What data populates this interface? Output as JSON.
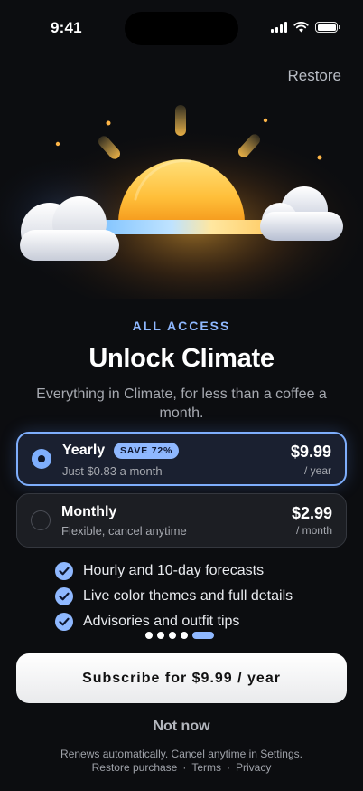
{
  "status": {
    "time": "9:41"
  },
  "header": {
    "restore_label": "Restore"
  },
  "hero": {
    "eyebrow": "ALL ACCESS",
    "title": "Unlock Climate",
    "subtitle": "Everything in Climate, for less than a coffee a month."
  },
  "plans": [
    {
      "name": "Yearly",
      "badge": "SAVE 72%",
      "subtitle": "Just $0.83 a month",
      "price": "$9.99",
      "period": "/ year",
      "selected": true
    },
    {
      "name": "Monthly",
      "subtitle": "Flexible, cancel anytime",
      "price": "$2.99",
      "period": "/ month",
      "selected": false
    }
  ],
  "features": [
    "Hourly and 10-day forecasts",
    "Live color themes and full details",
    "Advisories and outfit tips"
  ],
  "pager": {
    "count": 5,
    "active_index": 4
  },
  "cta": {
    "subscribe_label": "Subscribe for $9.99 / year",
    "not_now_label": "Not now"
  },
  "footer": {
    "renew_text": "Renews automatically. Cancel anytime in Settings.",
    "links": [
      "Restore purchase",
      "Terms",
      "Privacy"
    ],
    "separator": "·"
  },
  "colors": {
    "accent": "#8fb8ff",
    "background": "#0c0d10",
    "sun": "#ffc83a"
  },
  "icons": {
    "check": "check-icon",
    "wifi": "wifi-icon",
    "signal": "signal-icon",
    "battery": "battery-icon"
  }
}
